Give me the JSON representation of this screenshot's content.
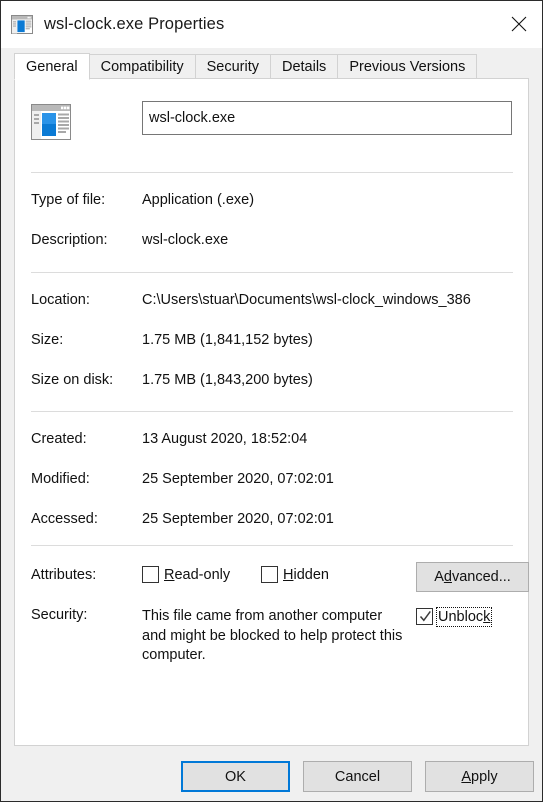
{
  "window": {
    "title": "wsl-clock.exe Properties",
    "icon": "application-window-icon",
    "close_label": "✕"
  },
  "tabs": [
    {
      "label": "General",
      "active": true
    },
    {
      "label": "Compatibility",
      "active": false
    },
    {
      "label": "Security",
      "active": false
    },
    {
      "label": "Details",
      "active": false
    },
    {
      "label": "Previous Versions",
      "active": false
    }
  ],
  "general": {
    "file_icon": "application-window-icon",
    "name_value": "wsl-clock.exe",
    "rows": [
      {
        "label": "Type of file:",
        "value": "Application (.exe)"
      },
      {
        "label": "Description:",
        "value": "wsl-clock.exe"
      },
      {
        "label": "Location:",
        "value": "C:\\Users\\stuar\\Documents\\wsl-clock_windows_386"
      },
      {
        "label": "Size:",
        "value": "1.75 MB (1,841,152 bytes)"
      },
      {
        "label": "Size on disk:",
        "value": "1.75 MB (1,843,200 bytes)"
      },
      {
        "label": "Created:",
        "value": "13 August 2020, 18:52:04"
      },
      {
        "label": "Modified:",
        "value": "25 September 2020, 07:02:01"
      },
      {
        "label": "Accessed:",
        "value": "25 September 2020, 07:02:01"
      }
    ],
    "attributes": {
      "label": "Attributes:",
      "readonly": {
        "label": "Read-only",
        "accel": "R",
        "rest": "ead-only",
        "checked": false
      },
      "hidden": {
        "label": "Hidden",
        "accel": "H",
        "rest": "idden",
        "checked": false
      },
      "advanced_button": {
        "pre": "A",
        "accel": "d",
        "rest": "vanced...",
        "label": "Advanced..."
      }
    },
    "security": {
      "label": "Security:",
      "message": "This file came from another computer and might be blocked to help protect this computer.",
      "unblock": {
        "pre": "Unbloc",
        "accel": "k",
        "label": "Unblock",
        "checked": true,
        "focused": true
      }
    }
  },
  "footer": {
    "ok": {
      "label": "OK",
      "default": true
    },
    "cancel": {
      "label": "Cancel"
    },
    "apply": {
      "pre": "",
      "accel": "A",
      "rest": "pply",
      "label": "Apply"
    }
  },
  "colors": {
    "accent": "#0078d7",
    "dialog_bg": "#f0f0f0",
    "panel_bg": "#ffffff",
    "button_bg": "#e1e1e1",
    "border": "#d2d2d2",
    "text": "#111111"
  }
}
